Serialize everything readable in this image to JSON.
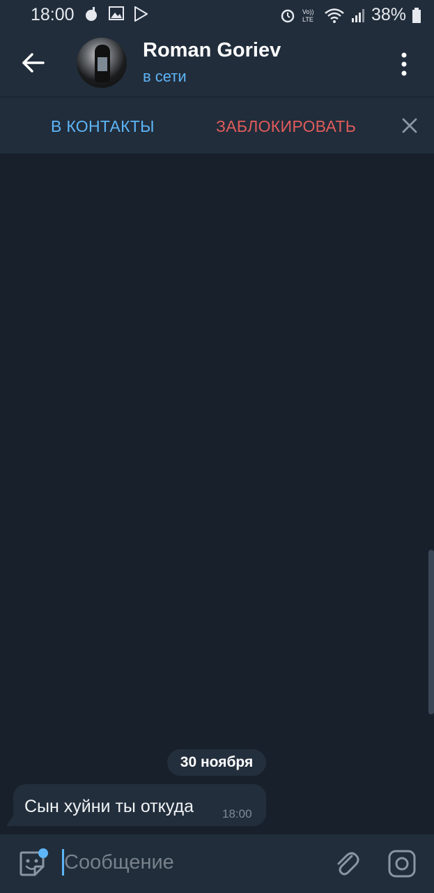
{
  "statusbar": {
    "time": "18:00",
    "battery": "38%"
  },
  "header": {
    "name": "Roman Goriev",
    "status": "в сети"
  },
  "actions": {
    "add_contact": "В КОНТАКТЫ",
    "block": "ЗАБЛОКИРОВАТЬ"
  },
  "chat": {
    "date": "30 ноября",
    "messages": [
      {
        "text": "Сын хуйни ты откуда",
        "time": "18:00"
      }
    ]
  },
  "composer": {
    "placeholder": "Сообщение"
  },
  "colors": {
    "accent": "#5eb5f7",
    "danger": "#e15b5b",
    "background": "#18202b",
    "panel": "#212d3b"
  }
}
